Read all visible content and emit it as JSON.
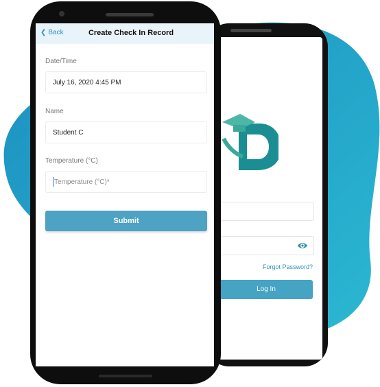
{
  "back_phone": {
    "forgot_password": "Forgot Password?",
    "login_button": "Log In"
  },
  "front_phone": {
    "nav": {
      "back_label": "Back",
      "title": "Create Check In Record"
    },
    "form": {
      "datetime_label": "Date/Time",
      "datetime_value": "July 16, 2020 4:45 PM",
      "name_label": "Name",
      "name_value": "Student C",
      "temperature_label": "Temperature (°C)",
      "temperature_placeholder": "Temperature (°C)*"
    },
    "submit_label": "Submit"
  },
  "colors": {
    "accent": "#4ea2c3",
    "link": "#2f8fc7",
    "blob": "#1f9cc7"
  }
}
